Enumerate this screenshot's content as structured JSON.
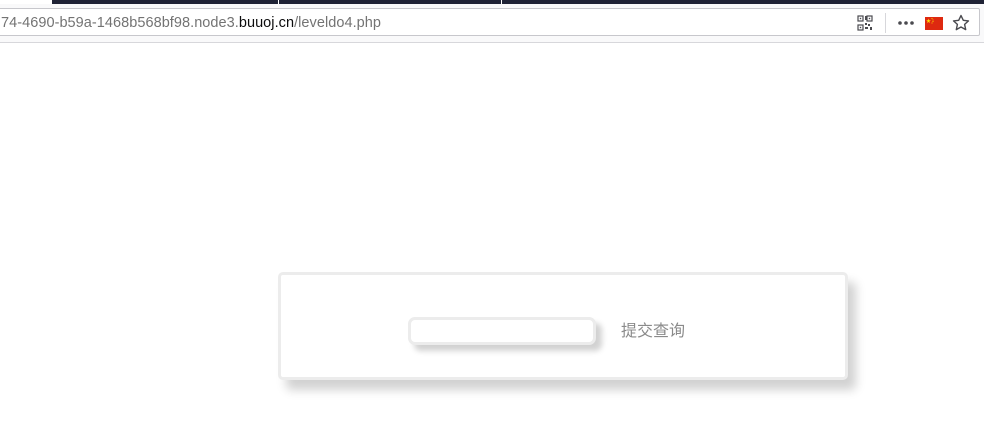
{
  "browser": {
    "url_prefix": "74-4690-b59a-1468b568bf98.node3.",
    "url_domain": "buuoj.cn",
    "url_path": "/leveldo4.php",
    "icons": [
      "qr-code-icon",
      "more-options-icon",
      "china-flag-icon",
      "bookmark-star-icon"
    ]
  },
  "form": {
    "query_value": "",
    "submit_label": "提交查询"
  },
  "colors": {
    "flag_red": "#de2910",
    "flag_yellow": "#ffde00",
    "card_border": "#ececec"
  }
}
